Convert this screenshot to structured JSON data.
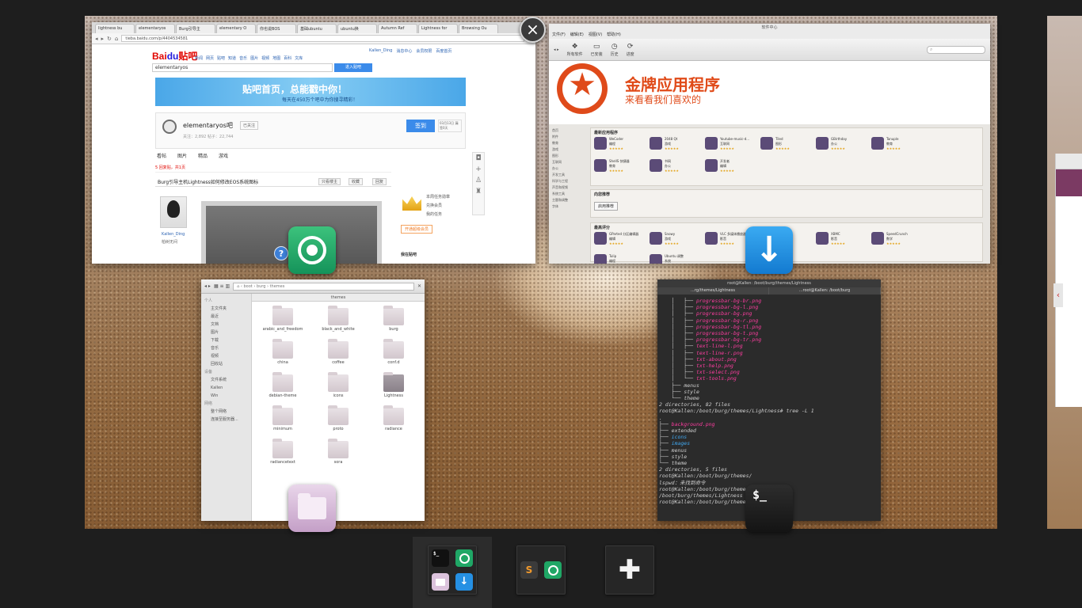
{
  "workspace_close": "×",
  "chrome": {
    "tabs": [
      "lightness bu",
      "elementaryos",
      "Burg引导主",
      "elementary O",
      "你也说BOS",
      "基础ubuntu",
      "ubuntu换",
      "Autumn Ref",
      "Lightness for",
      "Browsing Ou"
    ],
    "url": "tieba.baidu.com/p/4404534581",
    "baidu": {
      "logo_a": "Bai",
      "logo_b": "du",
      "logo_c": "贴吧",
      "nav": [
        "新闻",
        "网页",
        "贴吧",
        "知道",
        "音乐",
        "图片",
        "视频",
        "地图",
        "百科",
        "文库"
      ],
      "user": [
        "Kallen_Ding",
        "消息中心",
        "会员权限",
        "百度首页"
      ],
      "search_value": "elementaryos",
      "search_btn": "进入贴吧",
      "banner_title": "贴吧首页，总能戳中你！",
      "banner_sub": "每天在450万个吧中为你搜寻精彩！",
      "forum_name": "elementaryos吧",
      "follow": "已关注",
      "stats": "关注：2,892   帖子：22,744",
      "sign": "签到",
      "date": "03月13日 漏签0天",
      "tabs": [
        "看帖",
        "图片",
        "精品",
        "游戏"
      ],
      "post_count": "5 回复贴，共1页",
      "post_title": "Burg引导主机Lightness如何修改EOS系统图标",
      "post_btns": [
        "只看楼主",
        "收藏",
        "回复"
      ],
      "user_name": "Kallen_Ding",
      "user_title": "柏树无间",
      "side_links": [
        "本周任务勋章",
        "兑换会员",
        "我的任务"
      ],
      "side_follow": "开通超级会员",
      "side_bottom": "我在贴吧"
    }
  },
  "software_center": {
    "title": "软件中心",
    "menu": [
      "文件(F)",
      "编辑(E)",
      "视图(V)",
      "帮助(H)"
    ],
    "toolbar": [
      "所有软件",
      "已安装",
      "历史",
      "进度"
    ],
    "search_placeholder": "",
    "banner_title": "金牌应用程序",
    "banner_sub": "来看看我们喜欢的",
    "categories": [
      "首页",
      "附件",
      "教育",
      "游戏",
      "图形",
      "互联网",
      "办公",
      "开发工具",
      "科学与工程",
      "声音和视频",
      "系统工具",
      "主题和调整",
      "字体"
    ],
    "panel_new": "最新应用程序",
    "panel_rec": "向您推荐",
    "rec_btn": "启用推荐",
    "panel_top": "最高评分",
    "new_apps": [
      {
        "name": "WeCoder",
        "sub": "编程"
      },
      {
        "name": "2048 Qt",
        "sub": "游戏"
      },
      {
        "name": "Youtube-music-d...",
        "sub": "互联网"
      },
      {
        "name": "Tiled",
        "sub": "图形"
      },
      {
        "name": "GBirthday",
        "sub": "办公"
      },
      {
        "name": "Tanuple",
        "sub": "教育"
      },
      {
        "name": "ShellS 快捷器",
        "sub": "教育"
      },
      {
        "name": "书网",
        "sub": "办公"
      },
      {
        "name": "开发者",
        "sub": "编辑"
      }
    ],
    "top_apps": [
      {
        "name": "GParted 分区编辑器",
        "sub": "编辑"
      },
      {
        "name": "Snowy",
        "sub": "游戏"
      },
      {
        "name": "VLC 多媒体播放器",
        "sub": "影音"
      },
      {
        "name": "Stellarium",
        "sub": "天文"
      },
      {
        "name": "XBMC",
        "sub": "影音"
      },
      {
        "name": "SpeedCrunch",
        "sub": "数学"
      },
      {
        "name": "Tulip",
        "sub": "编程"
      },
      {
        "name": "Ubuntu 调整",
        "sub": "系统"
      }
    ]
  },
  "files": {
    "crumb": [
      "boot",
      "burg",
      "themes"
    ],
    "tab": "themes",
    "sidebar": {
      "sec_personal": "个人",
      "items": [
        "主文件夹",
        "最近",
        "文档",
        "图片",
        "下载",
        "音乐",
        "视频",
        "回收站"
      ],
      "sec_devices": "设备",
      "devices": [
        "文件系统",
        "Kallen",
        "Win"
      ],
      "sec_network": "网络",
      "network": [
        "整个网络",
        "连接至服务器..."
      ]
    },
    "folders": [
      "arabic_and_freedom",
      "black_and_white",
      "burg",
      "china",
      "coffee",
      "conf.d",
      "debian-theme",
      "icons",
      "Lightness",
      "minimum",
      "proto",
      "radiance",
      "radiancetext",
      "sora"
    ]
  },
  "terminal": {
    "title": "root@Kallen: /boot/burg/themes/Lightness",
    "tabs": [
      "...rg/themes/Lightness",
      "...root@Kallen: /boot/burg"
    ],
    "lines": [
      {
        "t": "    │   ├── ",
        "k": "progressbar-bg-br.png",
        "c": "pk"
      },
      {
        "t": "    │   ├── ",
        "k": "progressbar-bg-l.png",
        "c": "pk"
      },
      {
        "t": "    │   ├── ",
        "k": "progressbar-bg.png",
        "c": "pk"
      },
      {
        "t": "    │   ├── ",
        "k": "progressbar-bg-r.png",
        "c": "pk"
      },
      {
        "t": "    │   ├── ",
        "k": "progressbar-bg-tl.png",
        "c": "pk"
      },
      {
        "t": "    │   ├── ",
        "k": "progressbar-bg-t.png",
        "c": "pk"
      },
      {
        "t": "    │   ├── ",
        "k": "progressbar-bg-tr.png",
        "c": "pk"
      },
      {
        "t": "    │   ├── ",
        "k": "text-line-l.png",
        "c": "pk"
      },
      {
        "t": "    │   ├── ",
        "k": "text-line-r.png",
        "c": "pk"
      },
      {
        "t": "    │   ├── ",
        "k": "txt-about.png",
        "c": "pk"
      },
      {
        "t": "    │   ├── ",
        "k": "txt-help.png",
        "c": "pk"
      },
      {
        "t": "    │   ├── ",
        "k": "txt-select.png",
        "c": "pk"
      },
      {
        "t": "    │   └── ",
        "k": "txt-tools.png",
        "c": "pk"
      },
      {
        "t": "    ├── ",
        "k": "menus",
        "c": "dim"
      },
      {
        "t": "    ├── ",
        "k": "style",
        "c": "dim"
      },
      {
        "t": "    └── ",
        "k": "theme",
        "c": "dim"
      },
      {
        "t": "",
        "k": "",
        "c": "dim"
      },
      {
        "t": "2 directories, 82 files",
        "k": "",
        "c": "dim"
      },
      {
        "t": "root@Kallen:/boot/burg/themes/Lightness# tree -L 1",
        "k": "",
        "c": "dim"
      },
      {
        "t": ".",
        "k": "",
        "c": "dim"
      },
      {
        "t": "├── ",
        "k": "background.png",
        "c": "pk"
      },
      {
        "t": "├── ",
        "k": "extended",
        "c": "dim"
      },
      {
        "t": "├── ",
        "k": "icons",
        "c": "bl"
      },
      {
        "t": "├── ",
        "k": "images",
        "c": "bl"
      },
      {
        "t": "├── ",
        "k": "menus",
        "c": "dim"
      },
      {
        "t": "├── ",
        "k": "style",
        "c": "dim"
      },
      {
        "t": "└── ",
        "k": "theme",
        "c": "dim"
      },
      {
        "t": "",
        "k": "",
        "c": "dim"
      },
      {
        "t": "2 directories, 5 files",
        "k": "",
        "c": "dim"
      },
      {
        "t": "root@Kallen:/boot/burg/themes/",
        "k": "",
        "c": "dim"
      },
      {
        "t": "lspwd：未找到命令",
        "k": "",
        "c": "dim"
      },
      {
        "t": "root@Kallen:/boot/burg/themes/",
        "k": "",
        "c": "dim"
      },
      {
        "t": "/boot/burg/themes/Lightness",
        "k": "",
        "c": "dim"
      },
      {
        "t": "root@Kallen:/boot/burg/themes/",
        "k": "",
        "c": "dim"
      }
    ]
  },
  "badges": {
    "terminal_prompt": "$_",
    "sw_arrow": "↓",
    "help": "?"
  },
  "dock": {
    "ws1_term": "$_",
    "ws2_sublime": "S",
    "add_workspace": "✚"
  },
  "side_arrow": "‹"
}
